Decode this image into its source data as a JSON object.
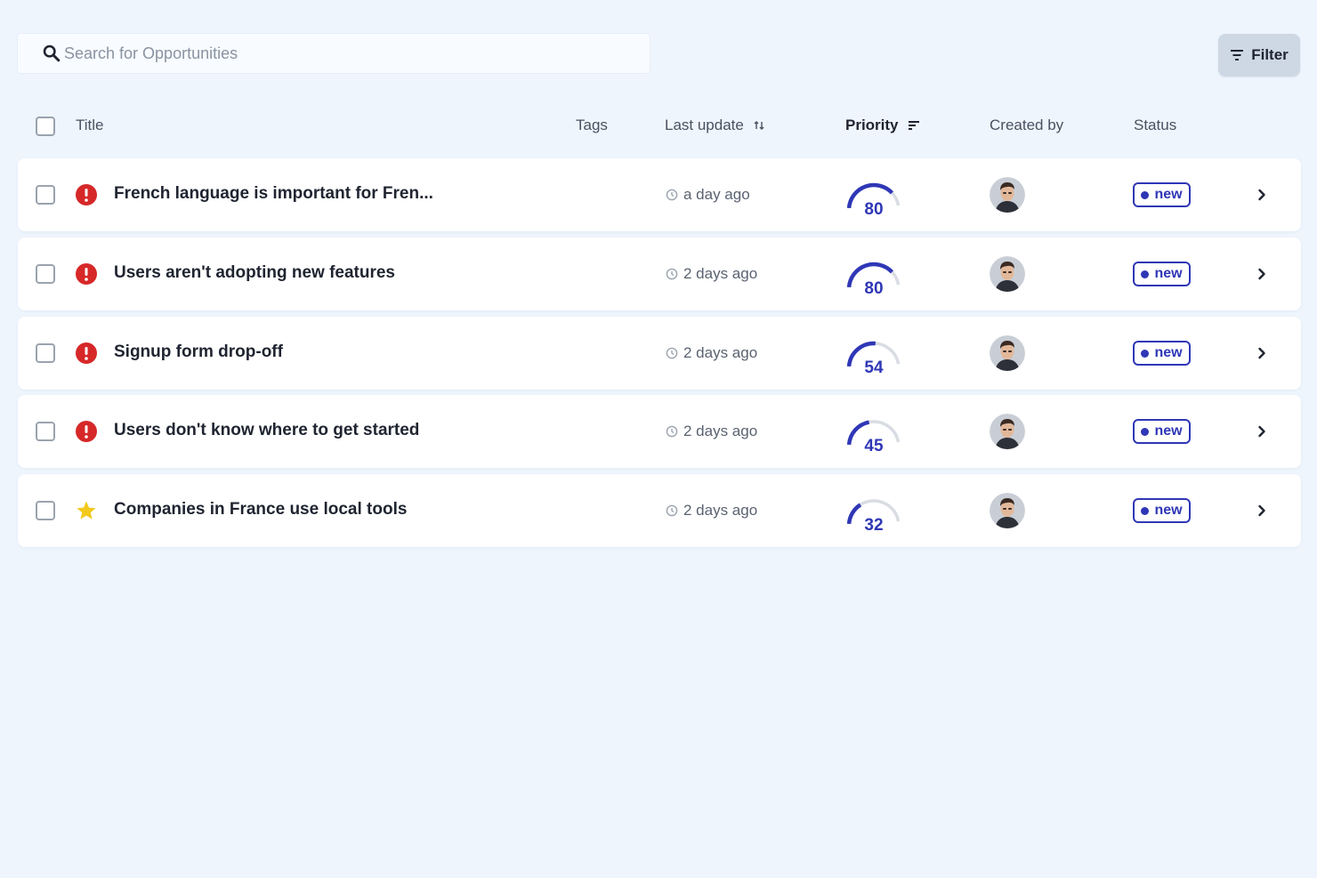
{
  "search": {
    "placeholder": "Search for Opportunities"
  },
  "filter": {
    "label": "Filter"
  },
  "columns": {
    "title": "Title",
    "tags": "Tags",
    "last_update": "Last update",
    "priority": "Priority",
    "created_by": "Created by",
    "status": "Status"
  },
  "colors": {
    "accent": "#2f37b6",
    "alert": "#d62828",
    "star": "#f2c91c",
    "gauge_track": "#d9dde3"
  },
  "rows": [
    {
      "type_icon": "alert-icon",
      "title": "French language is important for Fren...",
      "updated": "a day ago",
      "priority": 80,
      "status": "new"
    },
    {
      "type_icon": "alert-icon",
      "title": "Users aren't adopting new features",
      "updated": "2 days ago",
      "priority": 80,
      "status": "new"
    },
    {
      "type_icon": "alert-icon",
      "title": "Signup form drop-off",
      "updated": "2 days ago",
      "priority": 54,
      "status": "new"
    },
    {
      "type_icon": "alert-icon",
      "title": "Users don't know where to get started",
      "updated": "2 days ago",
      "priority": 45,
      "status": "new"
    },
    {
      "type_icon": "star-icon",
      "title": "Companies in France use local tools",
      "updated": "2 days ago",
      "priority": 32,
      "status": "new"
    }
  ]
}
